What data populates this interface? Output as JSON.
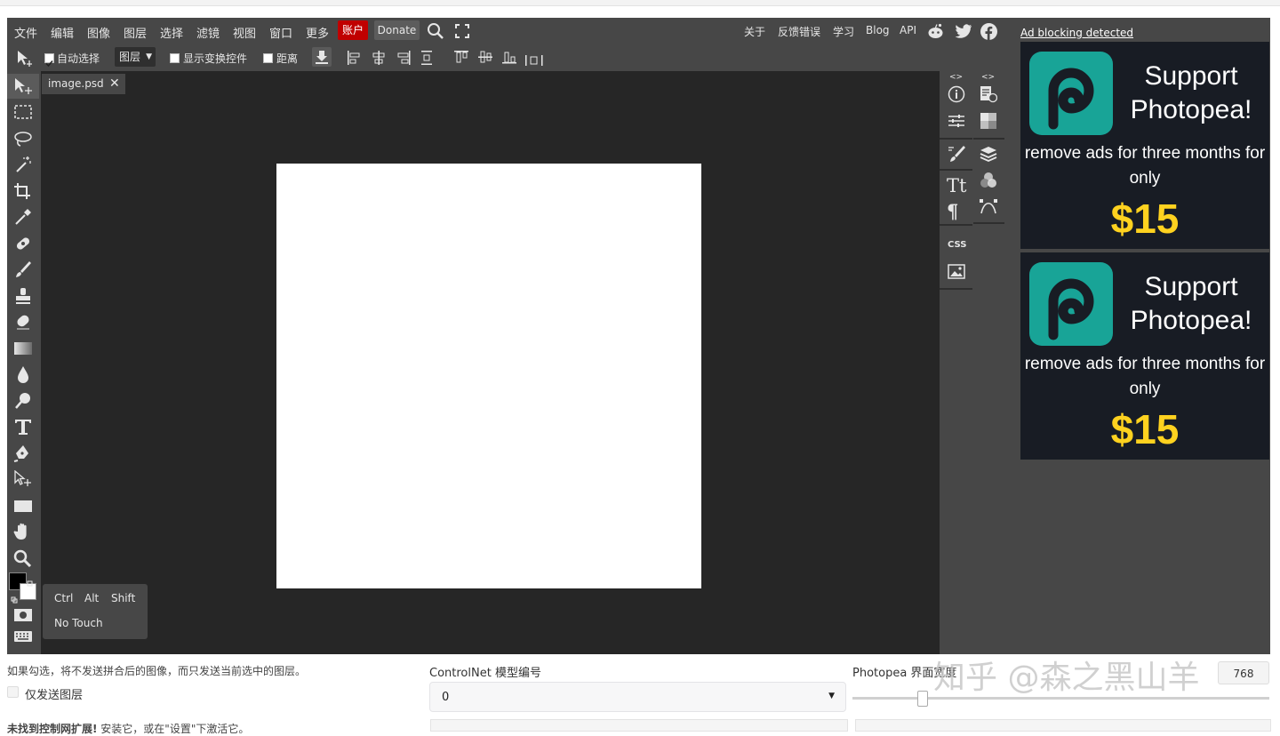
{
  "menubar": {
    "items": [
      "文件",
      "编辑",
      "图像",
      "图层",
      "选择",
      "滤镜",
      "视图",
      "窗口",
      "更多"
    ],
    "account": "账户",
    "donate": "Donate",
    "right_items": [
      "关于",
      "反馈错误",
      "学习",
      "Blog",
      "API"
    ]
  },
  "options": {
    "auto_select_label": "自动选择",
    "auto_select_checked": true,
    "layer_select_value": "图层",
    "transform_controls_label": "显示变换控件",
    "distance_label": "距离"
  },
  "document": {
    "tab_name": "image.psd"
  },
  "keys": {
    "modifiers": [
      "Ctrl",
      "Alt",
      "Shift"
    ],
    "touch": "No Touch"
  },
  "right_panel": {
    "css_label": "CSS"
  },
  "ads": {
    "blocking_notice": "Ad blocking detected",
    "cards": [
      {
        "title_line1": "Support",
        "title_line2": "Photopea!",
        "subtitle": "remove ads for three months for only",
        "price": "$15"
      },
      {
        "title_line1": "Support",
        "title_line2": "Photopea!",
        "subtitle": "remove ads for three months for only",
        "price": "$15"
      }
    ],
    "accent_color": "#18a497",
    "price_color": "#ffd21f"
  },
  "lower": {
    "hint": "如果勾选，将不发送拼合后的图像，而只发送当前选中的图层。",
    "only_send_layer_label": "仅发送图层",
    "controlnet_label": "ControlNet 模型编号",
    "controlnet_value": "0",
    "photopea_label": "Photopea 界面宽度",
    "photopea_value": "768",
    "partial_warning_bold": "未找到控制网扩展!",
    "partial_warning": " 安装它，或在\"设置\"下激活它。"
  },
  "watermark": "知乎 @森之黑山羊"
}
